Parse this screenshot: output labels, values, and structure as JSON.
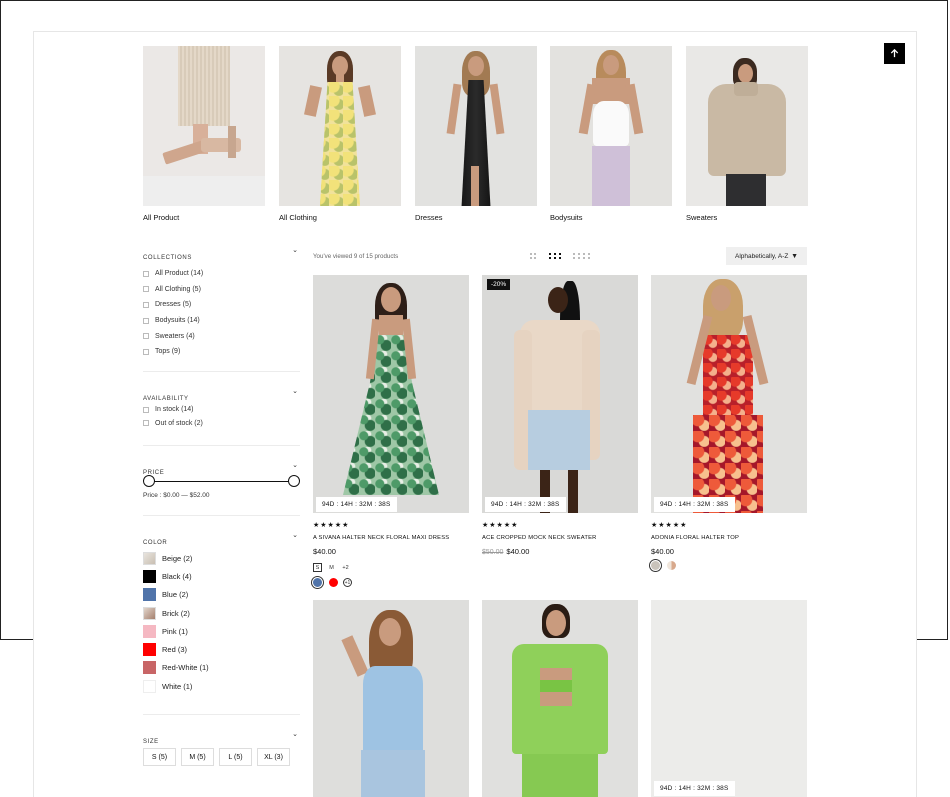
{
  "collections": [
    {
      "label": "All Product"
    },
    {
      "label": "All Clothing"
    },
    {
      "label": "Dresses"
    },
    {
      "label": "Bodysuits"
    },
    {
      "label": "Sweaters"
    }
  ],
  "filters": {
    "collections": {
      "title": "COLLECTIONS",
      "options": [
        "All Product (14)",
        "All Clothing (5)",
        "Dresses (5)",
        "Bodysuits (14)",
        "Sweaters (4)",
        "Tops (9)"
      ]
    },
    "availability": {
      "title": "AVAILABILITY",
      "options": [
        "In stock (14)",
        "Out of stock (2)"
      ]
    },
    "price": {
      "title": "PRICE",
      "summary": "Price :  $0.00 — $52.00",
      "min_fraction": 0,
      "max_fraction": 1
    },
    "color": {
      "title": "COLOR",
      "options": [
        {
          "label": "Beige (2)",
          "swatch": "#d8d2c8"
        },
        {
          "label": "Black (4)",
          "swatch": "#000000"
        },
        {
          "label": "Blue (2)",
          "swatch": "#5074aa"
        },
        {
          "label": "Brick (2)",
          "swatch": "#b89584"
        },
        {
          "label": "Pink (1)",
          "swatch": "#f5b8c2"
        },
        {
          "label": "Red (3)",
          "swatch": "#ff0000"
        },
        {
          "label": "Red-White (1)",
          "swatch": "#c86566"
        },
        {
          "label": "White (1)",
          "swatch": "#ffffff"
        }
      ]
    },
    "size": {
      "title": "SIZE",
      "options": [
        "S (5)",
        "M (5)",
        "L (5)",
        "XL (3)"
      ]
    }
  },
  "toolbar": {
    "count_text": "You've viewed 9 of 15 products",
    "sort_label": "Alphabetically, A-Z",
    "active_view": "3-columns"
  },
  "products": [
    {
      "timer": "94D : 14H : 32M : 38S",
      "rating": "★★★★★",
      "name": "A SIVANA HALTER NECK FLORAL MAXI DRESS",
      "price": "$40.00",
      "sizes": [
        "S",
        "M",
        "+2"
      ],
      "selected_size": "S",
      "colors": [
        "#5074aa",
        "#ff0000"
      ],
      "more_colors": "+1"
    },
    {
      "badge": "-20%",
      "timer": "94D : 14H : 32M : 38S",
      "rating": "★★★★★",
      "name": "ACE CROPPED MOCK NECK SWEATER",
      "old_price": "$50.00",
      "price": "$40.00"
    },
    {
      "timer": "94D : 14H : 32M : 38S",
      "rating": "★★★★★",
      "name": "ADONIA FLORAL HALTER TOP",
      "price": "$40.00",
      "colors": [
        "#c9c3bb",
        "#d8b7a2"
      ]
    },
    {},
    {},
    {
      "timer": "94D : 14H : 32M : 38S"
    }
  ]
}
